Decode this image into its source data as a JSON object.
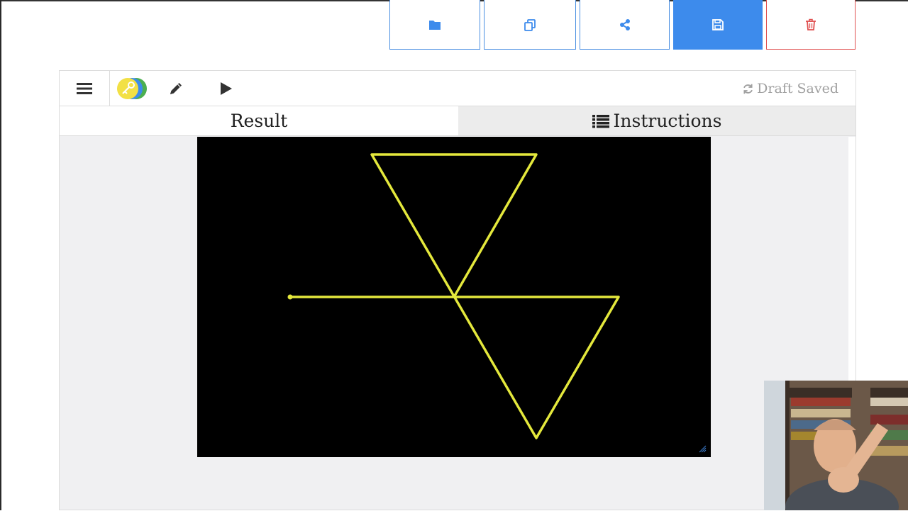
{
  "actions": {
    "open": "folder-icon",
    "duplicate": "copy-icon",
    "share": "share-icon",
    "save": "save-icon",
    "delete": "trash-icon"
  },
  "toolbar": {
    "menu": "hamburger-icon",
    "status_text": "Draft Saved"
  },
  "tabs": {
    "result": "Result",
    "instructions": "Instructions"
  },
  "colors": {
    "accent": "#3d8bec",
    "danger": "#e05050",
    "drawing_line": "#e4e83c",
    "canvas_bg": "#000000"
  }
}
